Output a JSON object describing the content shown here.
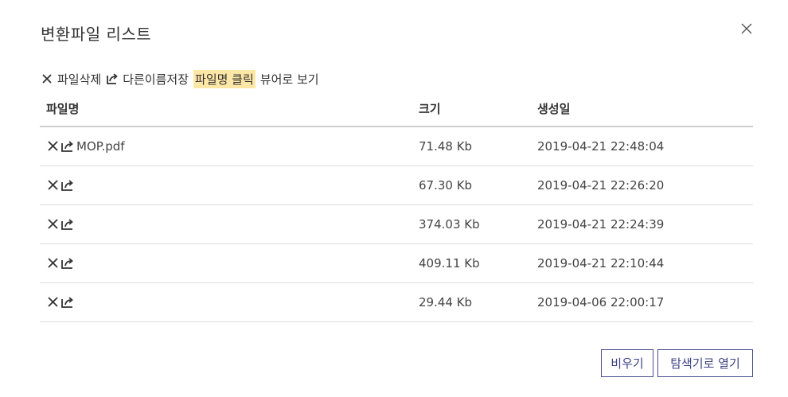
{
  "dialog": {
    "title": "변환파일 리스트",
    "close_icon": "close-icon"
  },
  "toolbar": {
    "delete_label": "파일삭제",
    "delete_icon": "x-icon",
    "save_as_label": "다른이름저장",
    "save_as_icon": "share-icon",
    "hint_highlight": "파일명 클릭",
    "hint_rest": "뷰어로 보기",
    "highlight_color": "#fde7a6"
  },
  "table": {
    "headers": {
      "name": "파일명",
      "size": "크기",
      "created": "생성일"
    },
    "rows": [
      {
        "name": "MOP.pdf",
        "size": "71.48 Kb",
        "created": "2019-04-21 22:48:04",
        "redacted": false
      },
      {
        "name": "",
        "size": "67.30 Kb",
        "created": "2019-04-21 22:26:20",
        "redacted": true
      },
      {
        "name": "",
        "size": "374.03 Kb",
        "created": "2019-04-21 22:24:39",
        "redacted": true
      },
      {
        "name": "",
        "size": "409.11 Kb",
        "created": "2019-04-21 22:10:44",
        "redacted": true
      },
      {
        "name": "",
        "size": "29.44 Kb",
        "created": "2019-04-06 22:00:17",
        "redacted": true
      }
    ]
  },
  "footer": {
    "clear_label": "비우기",
    "open_explorer_label": "탐색기로 열기",
    "button_color": "#3d4386"
  }
}
